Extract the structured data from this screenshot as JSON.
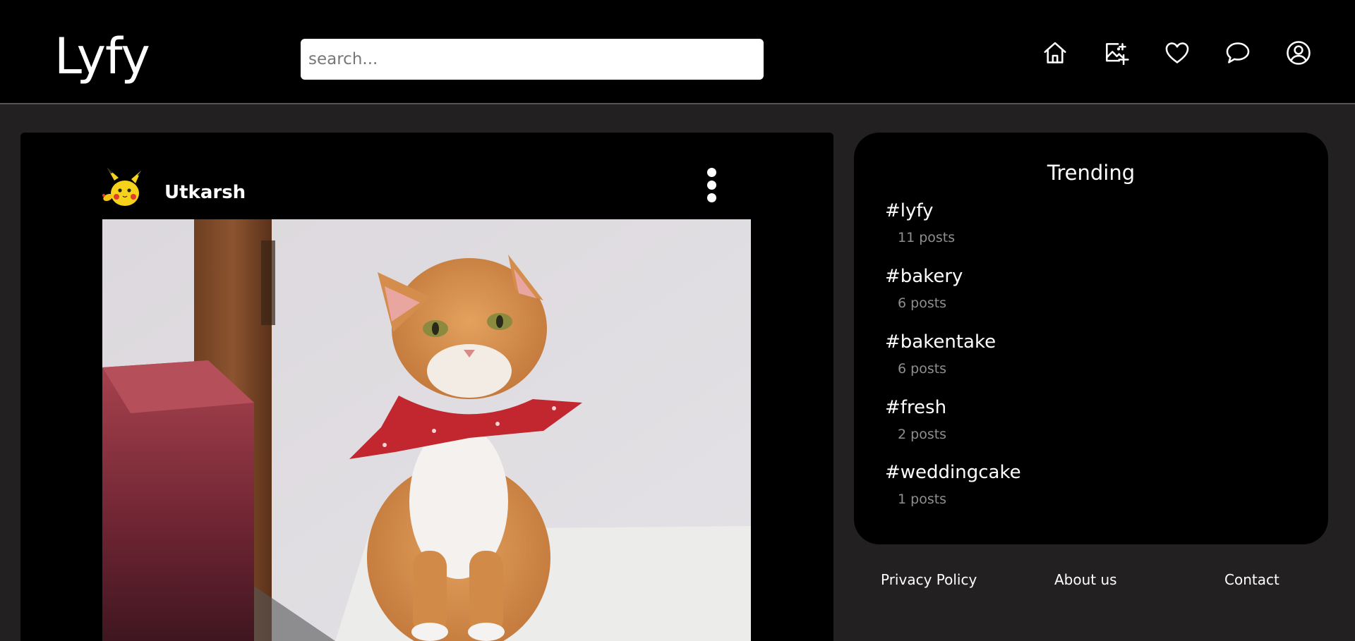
{
  "header": {
    "logo": "Lyfy",
    "search_placeholder": "search...",
    "icons": [
      "home-icon",
      "add-image-icon",
      "heart-icon",
      "chat-icon",
      "profile-icon"
    ]
  },
  "post": {
    "username": "Utkarsh",
    "avatar": "pikachu-avatar",
    "image": "orange cat wearing red bandana"
  },
  "trending": {
    "title": "Trending",
    "items": [
      {
        "tag": "#lyfy",
        "count": "11 posts"
      },
      {
        "tag": "#bakery",
        "count": "6 posts"
      },
      {
        "tag": "#bakentake",
        "count": "6 posts"
      },
      {
        "tag": "#fresh",
        "count": "2 posts"
      },
      {
        "tag": "#weddingcake",
        "count": "1 posts"
      }
    ]
  },
  "footer": {
    "links": [
      "Privacy Policy",
      "About us",
      "Contact"
    ]
  },
  "colors": {
    "page_bg": "#222021",
    "panel_bg": "#000000",
    "text": "#ffffff",
    "muted": "#8f8f8f"
  }
}
